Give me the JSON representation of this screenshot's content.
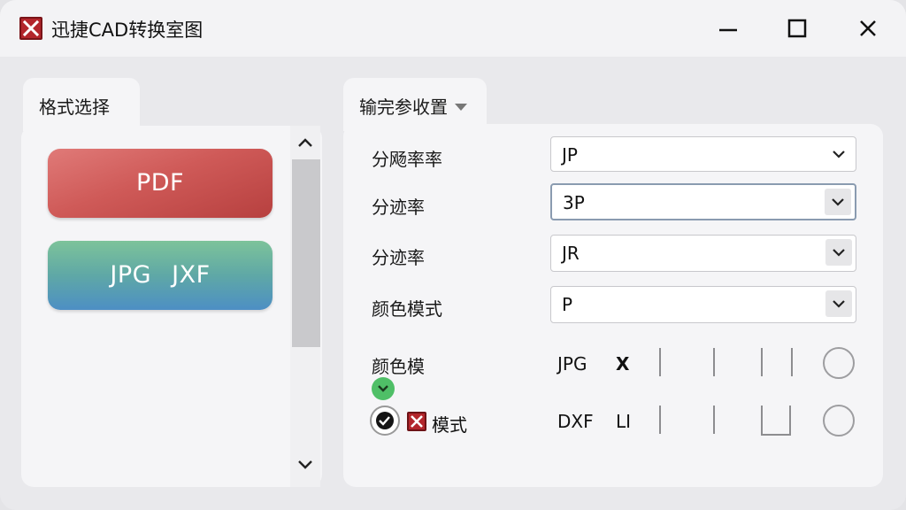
{
  "window": {
    "title": "迅捷CAD转换室图",
    "controls": {
      "minimize": "minimize",
      "maximize": "maximize",
      "close": "close"
    }
  },
  "left_panel": {
    "tab_label": "格式选择",
    "formats": [
      "PDF",
      "JPG  JXF"
    ]
  },
  "right_panel": {
    "tab_label": "输完参收置",
    "fields": [
      {
        "label": "分飏率率",
        "value": "JP"
      },
      {
        "label": "分迹率",
        "value": "3P"
      },
      {
        "label": "分迹率",
        "value": "JR"
      },
      {
        "label": "颜色模式",
        "value": "P"
      }
    ],
    "options_label": "颜色模",
    "option_row_1": {
      "format": "JPG",
      "mark": "X"
    },
    "option_row_2": {
      "label": "模式",
      "format": "DXF",
      "mark": "LI"
    }
  },
  "colors": {
    "accent_red": "#b3262c",
    "pdf_button": "#cf5a58",
    "jpg_button_top": "#7dc39a",
    "jpg_button_bottom": "#4d8fc4",
    "green_badge": "#4fbf67"
  }
}
